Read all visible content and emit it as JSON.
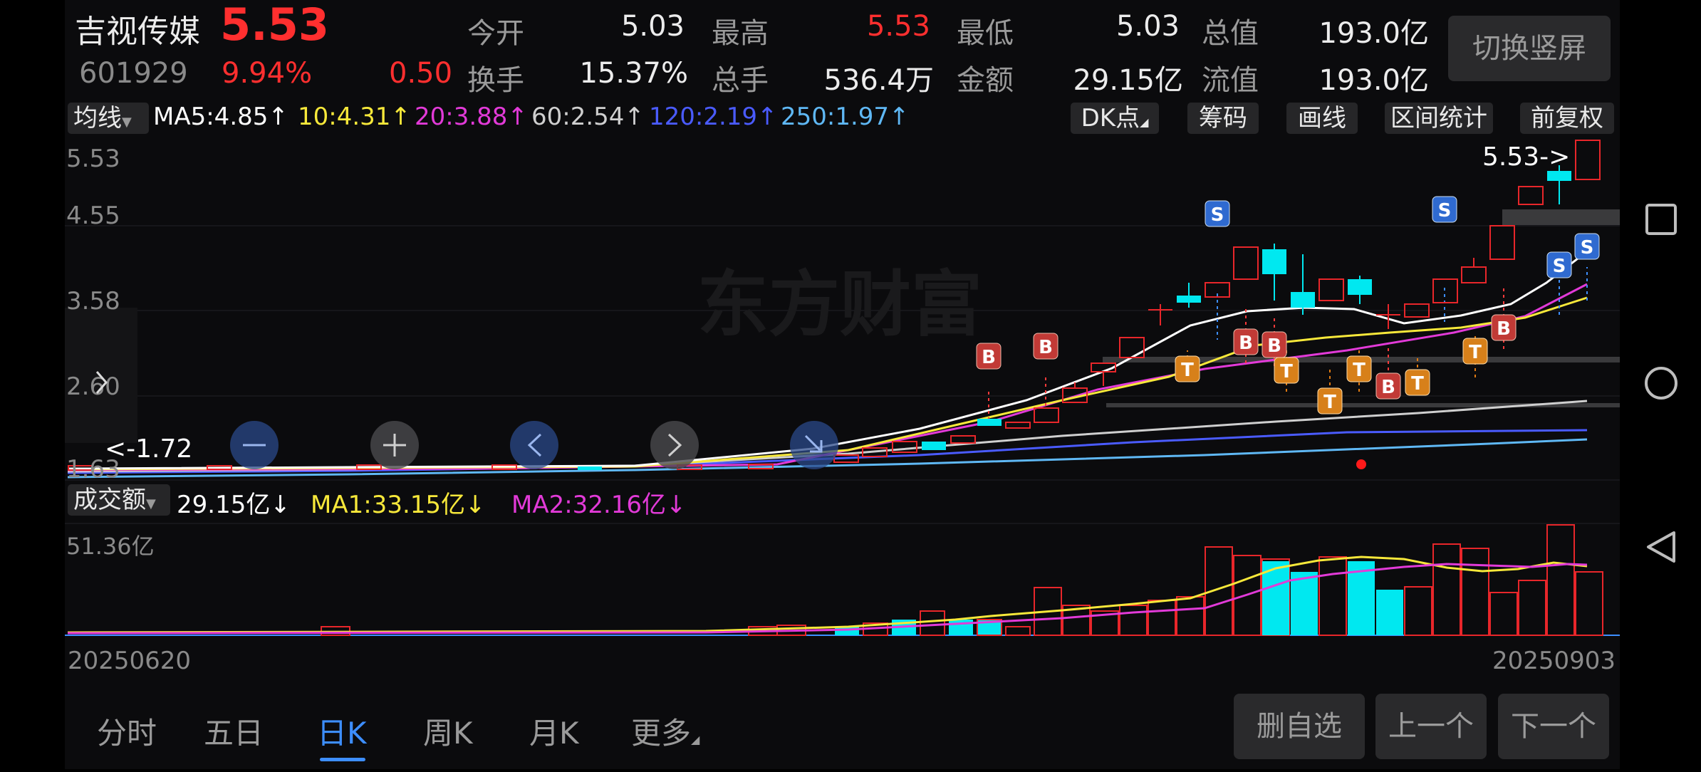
{
  "stock": {
    "name": "吉视传媒",
    "price": "5.53",
    "code": "601929",
    "change_pct": "9.94%",
    "change": "0.50"
  },
  "stats": [
    {
      "label": "今开",
      "value": "5.03",
      "color": "#ececec"
    },
    {
      "label": "最高",
      "value": "5.53",
      "color": "#ff2f2f"
    },
    {
      "label": "最低",
      "value": "5.03",
      "color": "#ececec"
    },
    {
      "label": "总值",
      "value": "193.0亿",
      "color": "#ececec"
    },
    {
      "label": "换手",
      "value": "15.37%",
      "color": "#ececec"
    },
    {
      "label": "总手",
      "value": "536.4万",
      "color": "#ececec"
    },
    {
      "label": "金额",
      "value": "29.15亿",
      "color": "#ececec"
    },
    {
      "label": "流值",
      "value": "193.0亿",
      "color": "#ececec"
    }
  ],
  "switch_button": "切换竖屏",
  "ma_bar": {
    "indicator": "均线",
    "items": [
      {
        "text": "MA5:4.85↑",
        "color": "#ffffff"
      },
      {
        "text": "10:4.31↑",
        "color": "#f7e83a"
      },
      {
        "text": "20:3.88↑",
        "color": "#e23ad8"
      },
      {
        "text": "60:2.54↑",
        "color": "#cfcfcf"
      },
      {
        "text": "120:2.19↑",
        "color": "#4a5bff"
      },
      {
        "text": "250:1.97↑",
        "color": "#5fb8f5"
      }
    ],
    "tools": [
      "DK点",
      "筹码",
      "画线",
      "区间统计",
      "前复权"
    ]
  },
  "price_axis": [
    "5.53",
    "4.55",
    "3.58",
    "2.60",
    "1.63"
  ],
  "price_annotations": {
    "max": "5.53->",
    "min": "<-1.72"
  },
  "watermark": "东方财富",
  "volume_bar": {
    "indicator": "成交额",
    "items": [
      {
        "text": "29.15亿↓",
        "color": "#ffffff"
      },
      {
        "text": "MA1:33.15亿↓",
        "color": "#f7e83a"
      },
      {
        "text": "MA2:32.16亿↓",
        "color": "#e23ad8"
      }
    ],
    "axis_max": "51.36亿"
  },
  "dates": {
    "start": "20250620",
    "end": "20250903"
  },
  "bottom_tabs": [
    {
      "label": "分时",
      "active": false
    },
    {
      "label": "五日",
      "active": false
    },
    {
      "label": "日K",
      "active": true
    },
    {
      "label": "周K",
      "active": false
    },
    {
      "label": "月K",
      "active": false
    },
    {
      "label": "更多",
      "active": false
    }
  ],
  "bottom_buttons": [
    "删自选",
    "上一个",
    "下一个"
  ],
  "markers": {
    "buy": "B",
    "sell": "S",
    "t": "T"
  },
  "colors": {
    "up": "#e8262a",
    "down": "#00e8f0",
    "accent": "#3d8eff"
  }
}
